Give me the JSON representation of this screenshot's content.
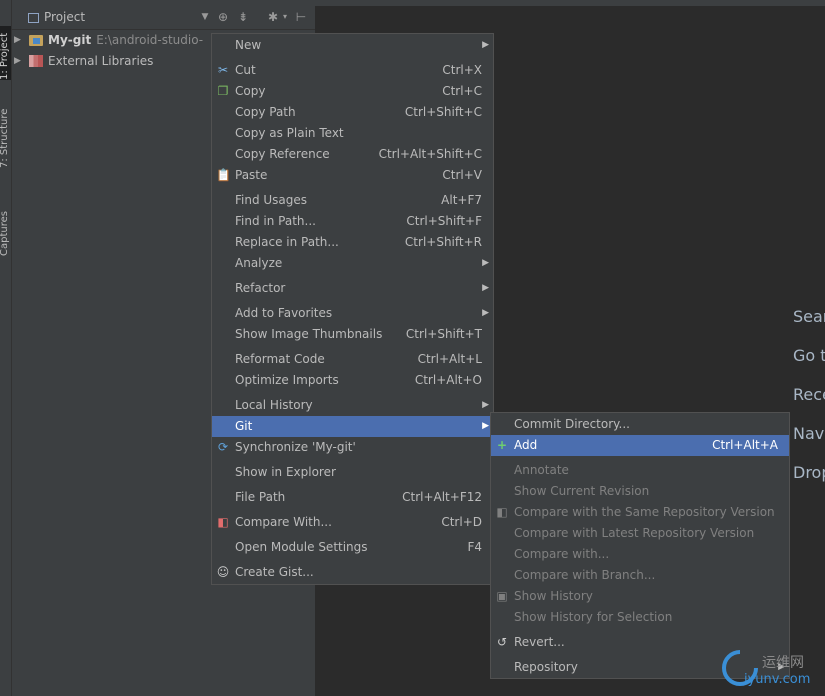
{
  "left_strip": {
    "tabs": [
      "1: Project",
      "7: Structure",
      "Captures"
    ]
  },
  "project_panel": {
    "title": "Project",
    "tree": [
      {
        "name": "My-git",
        "path": "E:\\android-studio-"
      },
      {
        "name": "External Libraries"
      }
    ]
  },
  "context_menu": {
    "items": [
      {
        "label": "New"
      },
      {
        "label": "Cut",
        "shortcut": "Ctrl+X"
      },
      {
        "label": "Copy",
        "shortcut": "Ctrl+C"
      },
      {
        "label": "Copy Path",
        "shortcut": "Ctrl+Shift+C"
      },
      {
        "label": "Copy as Plain Text"
      },
      {
        "label": "Copy Reference",
        "shortcut": "Ctrl+Alt+Shift+C"
      },
      {
        "label": "Paste",
        "shortcut": "Ctrl+V"
      },
      {
        "label": "Find Usages",
        "shortcut": "Alt+F7"
      },
      {
        "label": "Find in Path...",
        "shortcut": "Ctrl+Shift+F"
      },
      {
        "label": "Replace in Path...",
        "shortcut": "Ctrl+Shift+R"
      },
      {
        "label": "Analyze"
      },
      {
        "label": "Refactor"
      },
      {
        "label": "Add to Favorites"
      },
      {
        "label": "Show Image Thumbnails",
        "shortcut": "Ctrl+Shift+T"
      },
      {
        "label": "Reformat Code",
        "shortcut": "Ctrl+Alt+L"
      },
      {
        "label": "Optimize Imports",
        "shortcut": "Ctrl+Alt+O"
      },
      {
        "label": "Local History"
      },
      {
        "label": "Git"
      },
      {
        "label": "Synchronize 'My-git'"
      },
      {
        "label": "Show in Explorer"
      },
      {
        "label": "File Path",
        "shortcut": "Ctrl+Alt+F12"
      },
      {
        "label": "Compare With...",
        "shortcut": "Ctrl+D"
      },
      {
        "label": "Open Module Settings",
        "shortcut": "F4"
      },
      {
        "label": "Create Gist..."
      }
    ]
  },
  "git_submenu": {
    "items": [
      {
        "label": "Commit Directory..."
      },
      {
        "label": "Add",
        "shortcut": "Ctrl+Alt+A"
      },
      {
        "label": "Annotate"
      },
      {
        "label": "Show Current Revision"
      },
      {
        "label": "Compare with the Same Repository Version"
      },
      {
        "label": "Compare with Latest Repository Version"
      },
      {
        "label": "Compare with..."
      },
      {
        "label": "Compare with Branch..."
      },
      {
        "label": "Show History"
      },
      {
        "label": "Show History for Selection"
      },
      {
        "label": "Revert..."
      },
      {
        "label": "Repository"
      }
    ]
  },
  "editor_hints": [
    "Sear",
    "Go t",
    "Rece",
    "Navi",
    "Drop"
  ],
  "watermark": {
    "line1": "运维网",
    "line2": "iyunv.com"
  },
  "colors": {
    "selection": "#4b6eaf",
    "menu_bg": "#3c3f41",
    "editor_bg": "#2b2b2b"
  }
}
